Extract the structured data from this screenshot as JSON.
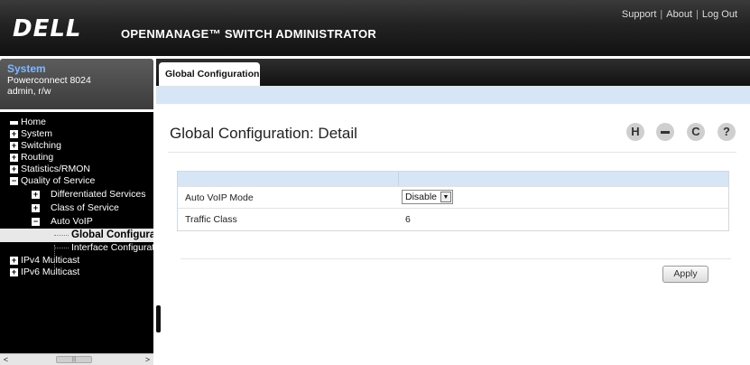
{
  "header": {
    "logo": "DELL",
    "app_title": "OPENMANAGE™ SWITCH ADMINISTRATOR",
    "links": {
      "support": "Support",
      "about": "About",
      "logout": "Log Out",
      "separator": "|"
    }
  },
  "system_box": {
    "title": "System",
    "device": "Powerconnect 8024",
    "user": "admin, r/w"
  },
  "nav": {
    "items": [
      {
        "label": "Home",
        "icon": "home-icon"
      },
      {
        "label": "System",
        "expander": "+"
      },
      {
        "label": "Switching",
        "expander": "+"
      },
      {
        "label": "Routing",
        "expander": "+"
      },
      {
        "label": "Statistics/RMON",
        "expander": "+"
      },
      {
        "label": "Quality of Service",
        "expander": "−"
      },
      {
        "label": "Differentiated Services",
        "expander": "+"
      },
      {
        "label": "Class of Service",
        "expander": "+"
      },
      {
        "label": "Auto VoIP",
        "expander": "−"
      },
      {
        "label": "Global Configura"
      },
      {
        "label": "Interface Configurat"
      },
      {
        "label": "IPv4 Multicast",
        "expander": "+"
      },
      {
        "label": "IPv6 Multicast",
        "expander": "+"
      }
    ],
    "scroll_left": "<",
    "scroll_right": ">",
    "scroll_grip": "|||"
  },
  "tabs": [
    {
      "label": "Global Configuration",
      "active": true
    }
  ],
  "main": {
    "title": "Global Configuration: Detail",
    "toolbar": {
      "save_glyph": "H",
      "print_glyph": "▬",
      "refresh_glyph": "C",
      "help_glyph": "?"
    },
    "rows": [
      {
        "label": "Auto VoIP Mode",
        "value": "Disable",
        "control": "select"
      },
      {
        "label": "Traffic Class",
        "value": "6"
      }
    ],
    "apply_label": "Apply"
  }
}
